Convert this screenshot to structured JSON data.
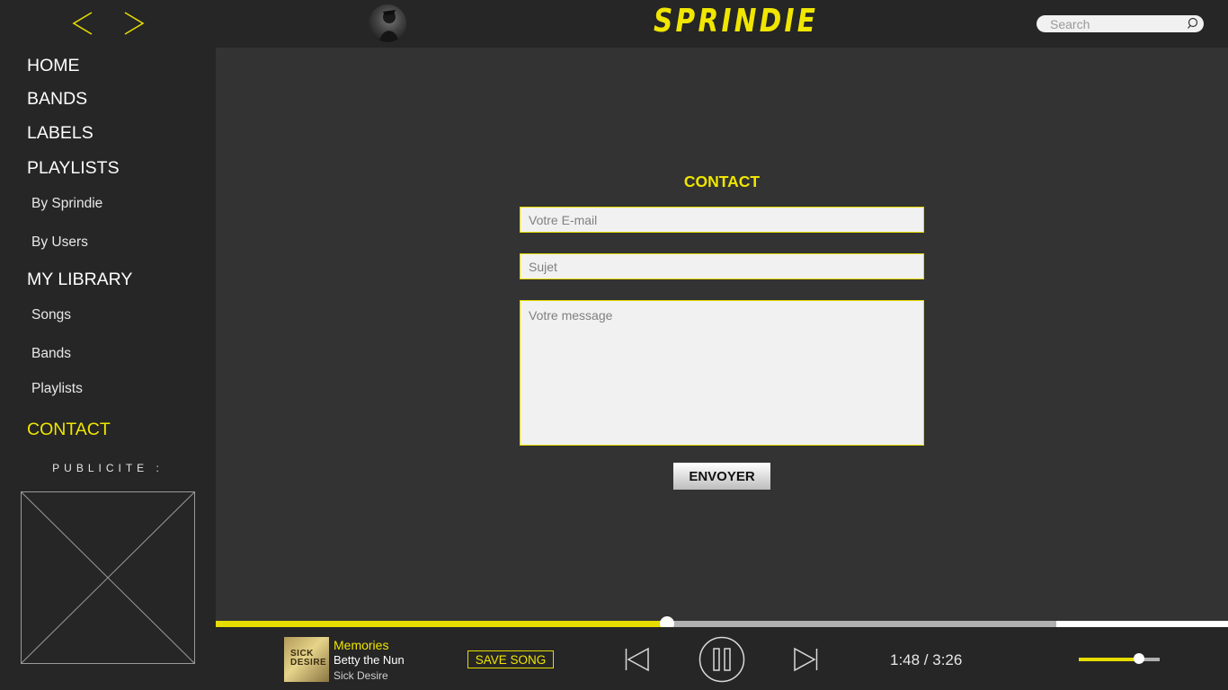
{
  "app": {
    "logo": "SPRINDIE"
  },
  "header": {
    "search_placeholder": "Search"
  },
  "sidebar": {
    "home": "HOME",
    "bands": "BANDS",
    "labels": "LABELS",
    "playlists": "PLAYLISTS",
    "by_sprindie": "By Sprindie",
    "by_users": "By Users",
    "my_library": "MY LIBRARY",
    "songs": "Songs",
    "lib_bands": "Bands",
    "lib_playlists": "Playlists",
    "contact": "CONTACT",
    "ad_label": "PUBLICITE :"
  },
  "contact_form": {
    "title": "CONTACT",
    "email_placeholder": "Votre E-mail",
    "subject_placeholder": "Sujet",
    "message_placeholder": "Votre message",
    "send_label": "ENVOYER"
  },
  "player": {
    "cover_text": "SICK DESIRE",
    "song_title": "Memories",
    "artist": "Betty the Nun",
    "album": "Sick Desire",
    "save_label": "SAVE SONG",
    "time": "1:48 / 3:26",
    "progress_fraction": 0.4455,
    "buffered_fraction": 0.83,
    "volume_fraction": 0.74
  },
  "colors": {
    "accent": "#f0e600",
    "background": "#333333",
    "panel": "#262626"
  }
}
